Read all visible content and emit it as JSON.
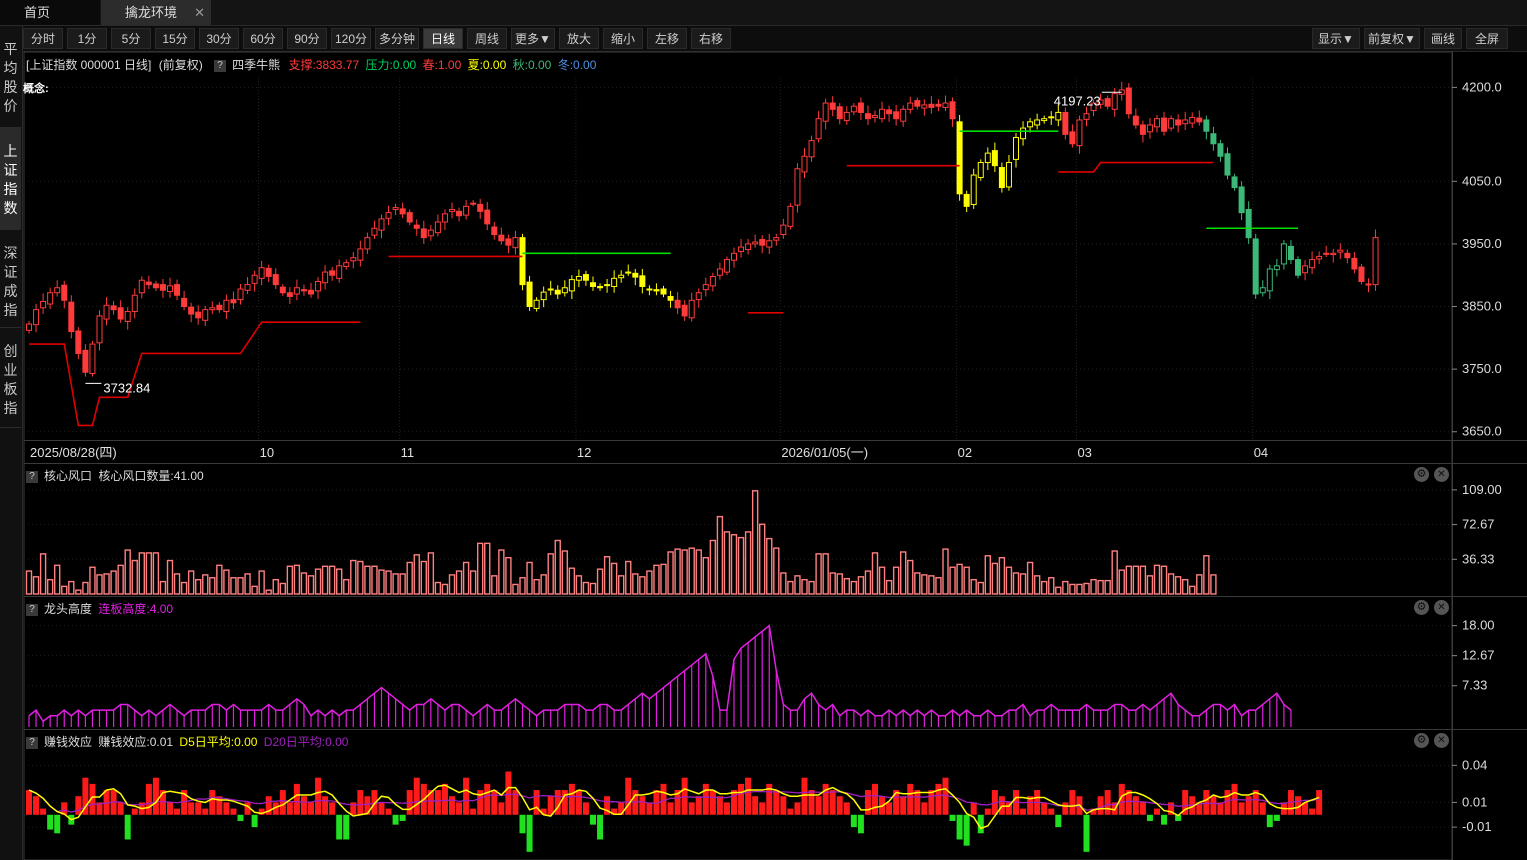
{
  "tabs": {
    "home": "首页",
    "active": "擒龙环境",
    "close": "✕"
  },
  "toolbar": {
    "periods": [
      "分时",
      "1分",
      "5分",
      "15分",
      "30分",
      "60分",
      "90分",
      "120分",
      "多分钟",
      "日线",
      "周线",
      "更多▼",
      "放大",
      "缩小",
      "左移",
      "右移"
    ],
    "active_period": "日线",
    "right": [
      "显示▼",
      "前复权▼",
      "画线",
      "全屏"
    ]
  },
  "sidebar": [
    "平均股价",
    "上证指数",
    "深证成指",
    "创业板指"
  ],
  "sidebar_active": "上证指数",
  "main_header": {
    "title": "[上证指数 000001 日线]",
    "adj": "(前复权)",
    "indicator": "四季牛熊",
    "support": "支撑:3833.77",
    "pressure": "压力:0.00",
    "spring": "春:1.00",
    "summer": "夏:0.00",
    "autumn": "秋:0.00",
    "winter": "冬:0.00",
    "concept": "概念:"
  },
  "panels": {
    "p1": {
      "name": "核心风口",
      "value": "核心风口数量:41.00"
    },
    "p2": {
      "name": "龙头高度",
      "value": "连板高度:4.00"
    },
    "p3": {
      "name": "赚钱效应",
      "value": "赚钱效应:0.01",
      "d5": "D5日平均:0.00",
      "d20": "D20日平均:0.00"
    }
  },
  "gear_icon": "⚙",
  "close_icon": "✕",
  "colors": {
    "up": "#ff3b3b",
    "down": "#00c864",
    "yellow": "#ffff00",
    "teal": "#3cb878",
    "magenta": "#e020e0",
    "vol": "#ff8080",
    "support_line": "#e00000",
    "resist_line": "#00e000"
  },
  "chart_data": [
    {
      "type": "candlestick",
      "title": "上证指数 000001 日线",
      "x_labels": [
        "2025/08/28(四)",
        "10",
        "11",
        "12",
        "2026/01/05(一)",
        "02",
        "03",
        "04"
      ],
      "x_label_index": [
        0,
        33,
        53,
        78,
        107,
        132,
        149,
        174
      ],
      "yticks": [
        3650,
        3750,
        3850,
        3950,
        4050,
        4200
      ],
      "ylim": [
        3640,
        4215
      ],
      "annotations": {
        "high": "4197.23",
        "low": "3732.84"
      },
      "closes": [
        3822,
        3845,
        3858,
        3872,
        3880,
        3860,
        3810,
        3775,
        3745,
        3790,
        3835,
        3852,
        3845,
        3830,
        3842,
        3868,
        3892,
        3885,
        3880,
        3876,
        3883,
        3868,
        3850,
        3838,
        3832,
        3845,
        3848,
        3845,
        3860,
        3856,
        3878,
        3885,
        3900,
        3912,
        3898,
        3885,
        3872,
        3866,
        3880,
        3875,
        3870,
        3890,
        3905,
        3900,
        3915,
        3920,
        3928,
        3942,
        3960,
        3975,
        3990,
        4000,
        4008,
        3998,
        3985,
        3975,
        3960,
        3972,
        3985,
        3998,
        4005,
        3995,
        4010,
        4015,
        4002,
        3982,
        3965,
        3955,
        3948,
        3960,
        3885,
        3850,
        3860,
        3873,
        3878,
        3870,
        3880,
        3893,
        3898,
        3892,
        3882,
        3880,
        3885,
        3895,
        3900,
        3905,
        3897,
        3882,
        3878,
        3875,
        3870,
        3860,
        3848,
        3835,
        3860,
        3872,
        3885,
        3898,
        3910,
        3925,
        3935,
        3945,
        3950,
        3953,
        3948,
        3955,
        3960,
        3980,
        4010,
        4070,
        4090,
        4115,
        4150,
        4175,
        4165,
        4150,
        4160,
        4170,
        4160,
        4150,
        4155,
        4165,
        4158,
        4150,
        4165,
        4175,
        4170,
        4172,
        4168,
        4170,
        4175,
        4150,
        4030,
        4010,
        4060,
        4080,
        4095,
        4075,
        4040,
        4080,
        4120,
        4135,
        4145,
        4148,
        4150,
        4152,
        4160,
        4125,
        4110,
        4148,
        4158,
        4175,
        4180,
        4170,
        4190,
        4196,
        4158,
        4140,
        4125,
        4140,
        4150,
        4130,
        4150,
        4140,
        4148,
        4152,
        4145,
        4130,
        4110,
        4090,
        4060,
        4040,
        4000,
        3960,
        3870,
        3880,
        3910,
        3915,
        3950,
        3925,
        3900,
        3915,
        3925,
        3930,
        3935,
        3935,
        3940,
        3928,
        3910,
        3890,
        3885,
        3960
      ],
      "support_line": [
        {
          "from": 0,
          "to": 5,
          "v": 3790
        },
        {
          "from": 7,
          "to": 9,
          "v": 3660
        },
        {
          "from": 10,
          "to": 14,
          "v": 3705
        },
        {
          "from": 16,
          "to": 30,
          "v": 3775
        },
        {
          "from": 33,
          "to": 47,
          "v": 3825
        },
        {
          "from": 51,
          "to": 70,
          "v": 3930
        },
        {
          "from": 102,
          "to": 107,
          "v": 3840
        },
        {
          "from": 116,
          "to": 132,
          "v": 4075
        },
        {
          "from": 146,
          "to": 151,
          "v": 4065
        },
        {
          "from": 152,
          "to": 168,
          "v": 4080
        }
      ],
      "resist_line": [
        {
          "from": 70,
          "to": 91,
          "v": 3935
        },
        {
          "from": 132,
          "to": 146,
          "v": 4130
        },
        {
          "from": 167,
          "to": 180,
          "v": 3975
        }
      ]
    },
    {
      "type": "bar",
      "title": "核心风口",
      "ylabel": "核心风口数量",
      "yticks": [
        36.33,
        72.67,
        109.0
      ],
      "ylim": [
        0,
        112
      ],
      "values": [
        24,
        18,
        42,
        15,
        30,
        8,
        13,
        4,
        12,
        28,
        20,
        21,
        24,
        30,
        46,
        35,
        43,
        43,
        43,
        13,
        35,
        21,
        12,
        24,
        15,
        20,
        17,
        30,
        25,
        17,
        17,
        21,
        8,
        24,
        4,
        15,
        11,
        29,
        30,
        22,
        19,
        26,
        29,
        29,
        26,
        15,
        35,
        34,
        29,
        29,
        25,
        24,
        21,
        21,
        33,
        41,
        34,
        43,
        12,
        10,
        20,
        24,
        33,
        24,
        53,
        53,
        19,
        46,
        38,
        10,
        17,
        33,
        15,
        20,
        42,
        56,
        45,
        27,
        19,
        12,
        11,
        26,
        39,
        32,
        19,
        34,
        21,
        18,
        24,
        30,
        31,
        44,
        47,
        46,
        48,
        46,
        38,
        56,
        81,
        65,
        62,
        59,
        65,
        108,
        73,
        58,
        48,
        22,
        13,
        19,
        15,
        13,
        42,
        42,
        22,
        21,
        16,
        13,
        18,
        24,
        43,
        28,
        14,
        28,
        44,
        35,
        22,
        20,
        19,
        17,
        47,
        28,
        31,
        28,
        15,
        12,
        40,
        32,
        38,
        28,
        22,
        21,
        33,
        19,
        13,
        17,
        7,
        13,
        10,
        10,
        11,
        15,
        14,
        14,
        45,
        25,
        29,
        29,
        29,
        19,
        30,
        29,
        21,
        18,
        15,
        8,
        20,
        40,
        20
      ],
      "type_colors": "red outline"
    },
    {
      "type": "bar",
      "title": "龙头高度",
      "ylabel": "连板高度",
      "yticks": [
        7.33,
        12.67,
        18.0
      ],
      "ylim": [
        0,
        19
      ],
      "values": [
        2,
        3,
        1,
        2,
        2,
        3,
        2,
        3,
        2,
        3,
        3,
        3,
        3,
        4,
        4,
        3,
        2,
        3,
        2,
        3,
        4,
        3,
        2,
        3,
        3,
        3,
        4,
        4,
        3,
        4,
        3,
        3,
        3,
        3,
        4,
        3,
        3,
        4,
        5,
        4,
        2,
        3,
        2,
        3,
        2,
        3,
        3,
        4,
        5,
        6,
        7,
        6,
        5,
        4,
        3,
        4,
        4,
        5,
        4,
        3,
        4,
        4,
        3,
        2,
        3,
        4,
        3,
        3,
        4,
        5,
        4,
        3,
        2,
        3,
        3,
        3,
        4,
        4,
        4,
        3,
        3,
        4,
        4,
        3,
        3,
        4,
        5,
        6,
        5,
        6,
        7,
        8,
        9,
        10,
        11,
        12,
        13,
        9,
        3,
        3,
        12,
        14,
        15,
        16,
        17,
        18,
        10,
        4,
        3,
        3,
        5,
        6,
        4,
        3,
        4,
        2,
        3,
        3,
        2,
        3,
        2,
        2,
        3,
        2,
        3,
        2,
        3,
        2,
        3,
        2,
        2,
        3,
        2,
        3,
        2,
        2,
        3,
        2,
        2,
        3,
        3,
        4,
        2,
        3,
        3,
        4,
        3,
        3,
        3,
        3,
        4,
        3,
        3,
        3,
        4,
        4,
        3,
        3,
        4,
        3,
        4,
        5,
        6,
        4,
        3,
        2,
        2,
        3,
        4,
        4,
        3,
        4,
        2,
        3,
        3,
        4,
        5,
        6,
        4,
        3
      ],
      "line": true
    },
    {
      "type": "bar",
      "title": "赚钱效应",
      "ylabel": "赚钱效应",
      "yticks": [
        0.04,
        0.01,
        -0.01
      ],
      "ylim": [
        -0.035,
        0.05
      ],
      "values": [
        0.02,
        0.015,
        0.005,
        -0.012,
        -0.015,
        0.01,
        -0.008,
        0.015,
        0.03,
        0.025,
        0.01,
        0.02,
        0.02,
        0.01,
        -0.02,
        0.005,
        0.01,
        0.025,
        0.03,
        0.02,
        0.01,
        0.005,
        0.02,
        0.01,
        0.01,
        0.005,
        0.02,
        0.015,
        0.01,
        0.005,
        -0.005,
        0.01,
        -0.01,
        0.005,
        0.015,
        0.01,
        0.02,
        0.01,
        0.025,
        0.015,
        0.01,
        0.03,
        0.015,
        0.01,
        -0.02,
        -0.02,
        0.01,
        0.02,
        0.015,
        0.02,
        0.01,
        0.005,
        -0.008,
        -0.005,
        0.02,
        0.03,
        0.025,
        0.02,
        0.02,
        0.025,
        0.015,
        0.01,
        0.03,
        0.005,
        0.02,
        0.025,
        0.02,
        0.01,
        0.035,
        0.02,
        -0.015,
        -0.03,
        0.02,
        0.005,
        0.015,
        0.02,
        0.02,
        0.025,
        0.02,
        0.01,
        -0.008,
        -0.02,
        0.015,
        0.005,
        0.01,
        0.03,
        0.02,
        0.015,
        0.01,
        0.02,
        0.025,
        0.01,
        0.02,
        0.03,
        0.01,
        0.015,
        0.025,
        0.02,
        0.015,
        0.01,
        0.02,
        0.025,
        0.03,
        0.015,
        0.01,
        0.025,
        0.02,
        0.015,
        0.005,
        0.01,
        0.03,
        0.02,
        0.015,
        0.025,
        0.02,
        0.015,
        0.01,
        -0.01,
        -0.015,
        0.02,
        0.025,
        0.015,
        0.01,
        0.02,
        0.015,
        0.025,
        0.02,
        0.01,
        0.02,
        0.025,
        0.03,
        -0.005,
        -0.02,
        -0.025,
        0.01,
        -0.015,
        0.005,
        0.02,
        0.015,
        0.01,
        0.02,
        0.005,
        0.015,
        0.02,
        0.01,
        0.005,
        -0.01,
        0.01,
        0.02,
        0.015,
        -0.03,
        0.005,
        0.015,
        0.02,
        0.01,
        0.025,
        0.02,
        0.015,
        0.01,
        -0.005,
        0.005,
        -0.008,
        0.01,
        -0.005,
        0.02,
        0.015,
        0.01,
        0.02,
        0.015,
        0.01,
        0.02,
        0.025,
        0.01,
        0.015,
        0.02,
        0.01,
        -0.01,
        -0.005,
        0.01,
        0.02,
        0.015,
        0.01,
        0.005,
        0.02
      ],
      "series": [
        {
          "name": "D5日平均"
        },
        {
          "name": "D20日平均"
        }
      ]
    }
  ]
}
